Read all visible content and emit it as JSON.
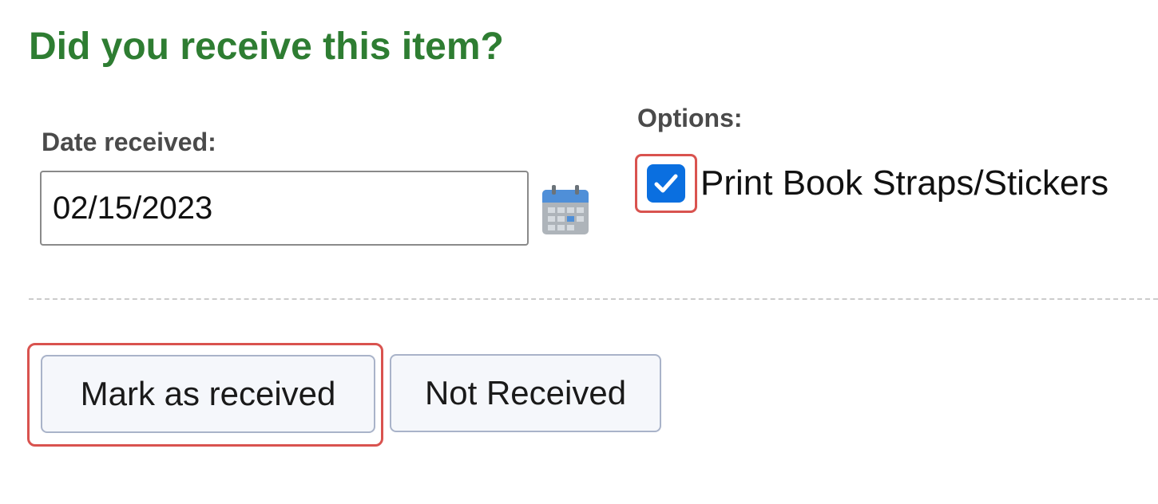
{
  "heading": "Did you receive this item?",
  "date_field": {
    "label": "Date received:",
    "value": "02/15/2023",
    "icon": "calendar-icon"
  },
  "options": {
    "label": "Options:",
    "items": [
      {
        "label": "Print Book Straps/Stickers",
        "checked": true
      }
    ]
  },
  "actions": {
    "mark_received": "Mark as received",
    "not_received": "Not Received"
  },
  "colors": {
    "heading": "#2e7d32",
    "highlight": "#d9534f",
    "checkbox": "#0a6fe0"
  }
}
